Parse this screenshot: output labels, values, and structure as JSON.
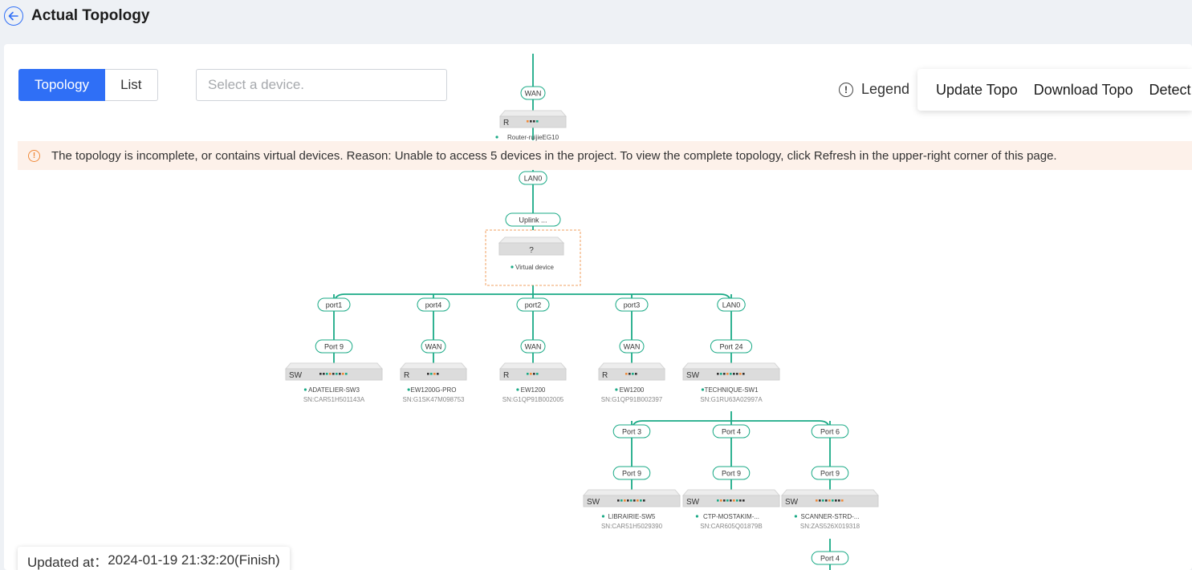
{
  "page": {
    "title": "Actual Topology"
  },
  "view_tabs": [
    "Topology",
    "List"
  ],
  "search": {
    "placeholder": "Select a device."
  },
  "legend_label": "Legend",
  "toolbar": {
    "update": "Update Topo",
    "download": "Download Topo",
    "detect": "Detect I"
  },
  "banner": {
    "text": "The topology is incomplete, or contains virtual devices. Reason: Unable to access 5 devices in the project. To view the complete topology, click Refresh in the upper-right corner of this page."
  },
  "updated": {
    "label": "Updated at：",
    "value": "2024-01-19 21:32:20(Finish)"
  },
  "colors": {
    "accent": "#2f6ff6",
    "link": "#1aaa86",
    "warning": "#f08a3a",
    "online": "#1aaa86"
  },
  "topology": {
    "root": {
      "up_port": "WAN",
      "type": "R",
      "name": "Router-ruijieEG10",
      "down_port": "LAN0"
    },
    "virtual": {
      "up_port": "Uplink ...",
      "glyph": "?",
      "name": "Virtual device"
    },
    "level1": [
      {
        "parent_port": "port1",
        "child_port": "Port 9",
        "type": "SW",
        "name": "ADATELIER-SW3",
        "sn": "SN:CAR51H501143A"
      },
      {
        "parent_port": "port4",
        "child_port": "WAN",
        "type": "R",
        "name": "EW1200G-PRO",
        "sn": "SN:G1SK47M098753"
      },
      {
        "parent_port": "port2",
        "child_port": "WAN",
        "type": "R",
        "name": "EW1200",
        "sn": "SN:G1QP91B002005"
      },
      {
        "parent_port": "port3",
        "child_port": "WAN",
        "type": "R",
        "name": "EW1200",
        "sn": "SN:G1QP91B002397"
      },
      {
        "parent_port": "LAN0",
        "child_port": "Port 24",
        "type": "SW",
        "name": "TECHNIQUE-SW1",
        "sn": "SN:G1RU63A02997A"
      }
    ],
    "level2": [
      {
        "parent_port": "Port 3",
        "child_port": "Port 9",
        "type": "SW",
        "name": "LIBRAIRIE-SW5",
        "sn": "SN:CAR51H5029390"
      },
      {
        "parent_port": "Port 4",
        "child_port": "Port 9",
        "type": "SW",
        "name": "CTP-MOSTAKIM-...",
        "sn": "SN:CAR605Q01879B"
      },
      {
        "parent_port": "Port 6",
        "child_port": "Port 9",
        "type": "SW",
        "name": "SCANNER-STRD-...",
        "sn": "SN:ZAS526X019318"
      }
    ],
    "level3": [
      {
        "parent_port": "Port 4"
      }
    ]
  }
}
